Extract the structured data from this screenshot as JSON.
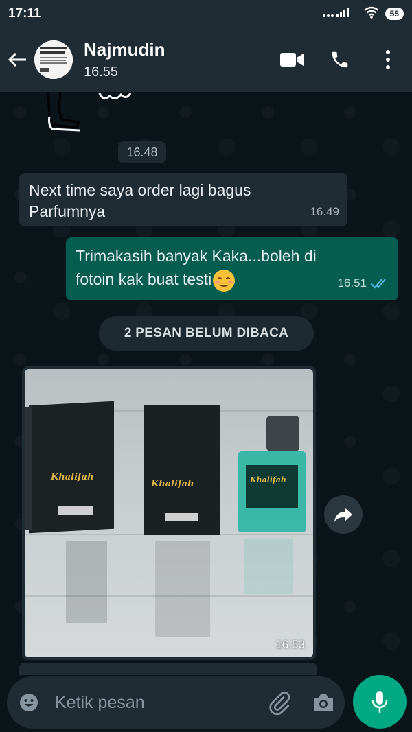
{
  "status_bar": {
    "time": "17:11",
    "signal_text": "....ıl",
    "battery": "55"
  },
  "header": {
    "contact_name": "Najmudin",
    "last_seen": "16.55"
  },
  "messages": {
    "sticker_time": "16.48",
    "incoming_text_line1": "Next time saya order lagi bagus",
    "incoming_text_line2": "Parfumnya",
    "incoming_time": "16.49",
    "outgoing_text_line1": "Trimakasih banyak Kaka...boleh di",
    "outgoing_text_line2": "fotoin kak buat testi",
    "outgoing_time": "16.51",
    "unread_label": "2 PESAN BELUM DIBACA",
    "photo_time": "16.53",
    "photo_label_1": "Khalifah",
    "photo_label_2": "Khalifah",
    "photo_label_3": "Khalifah"
  },
  "input": {
    "placeholder": "Ketik pesan"
  },
  "colors": {
    "header_bg": "#1f2c34",
    "outgoing_bubble": "#055d4f",
    "incoming_bubble": "#1f2c33",
    "accent": "#00a884",
    "read_ticks": "#53bdeb"
  },
  "icons": [
    "back-arrow-icon",
    "video-call-icon",
    "phone-icon",
    "more-vert-icon",
    "double-check-icon",
    "forward-icon",
    "emoji-icon",
    "attach-icon",
    "camera-icon",
    "mic-icon"
  ]
}
